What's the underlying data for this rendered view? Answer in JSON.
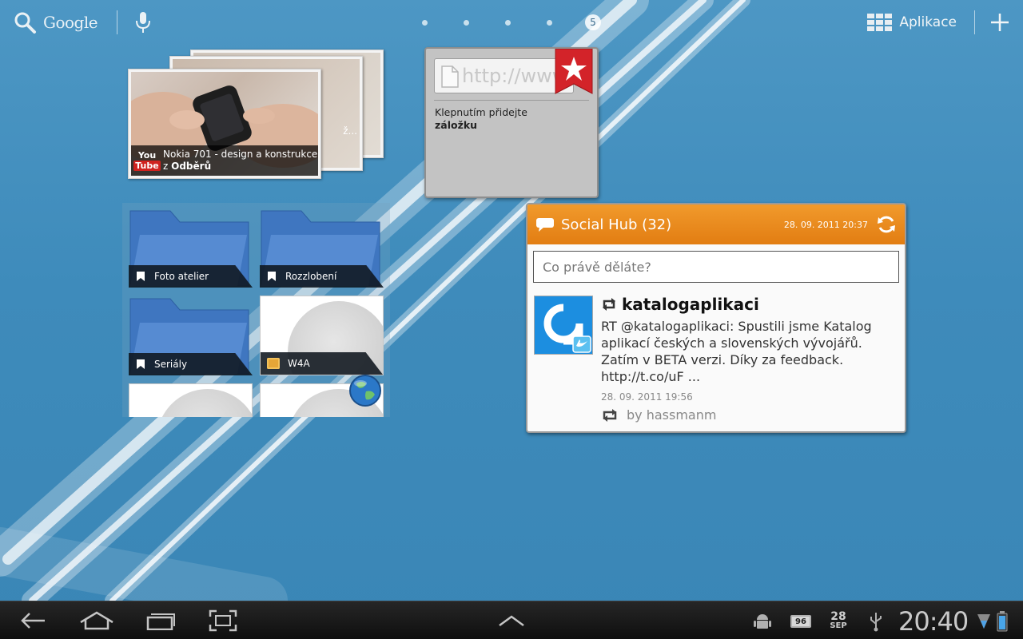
{
  "topbar": {
    "search_label": "Google",
    "page_number": "5",
    "apps_label": "Aplikace"
  },
  "youtube_widget": {
    "video_title": "Nokia 701 - design a konstrukce",
    "source_prefix": "z",
    "source_name": "Odběrů",
    "back_card_snippet": "ž...",
    "logo_top": "You",
    "logo_bottom": "Tube"
  },
  "bookmark_widget": {
    "url_placeholder": "http://www",
    "hint_line1": "Klepnutím přidejte",
    "hint_line2": "záložku"
  },
  "folders": {
    "items": [
      {
        "label": "Foto atelier"
      },
      {
        "label": "Rozzlobení"
      },
      {
        "label": "Seriály"
      },
      {
        "label": "W4A"
      }
    ]
  },
  "social_hub": {
    "title": "Social Hub (32)",
    "timestamp": "28. 09. 2011 20:37",
    "status_placeholder": "Co právě děláte?",
    "post": {
      "user": "katalogaplikaci",
      "text": "RT @katalogaplikaci: Spustili jsme Katalog aplikací českých a slovenských vývojářů. Zatím v BETA verzi. Díky za feedback. http://t.co/uF ...",
      "date": "28. 09. 2011 19:56",
      "by": "by hassmanm"
    },
    "accent_color": "#e98a1e"
  },
  "systembar": {
    "clock": "20:40",
    "calendar_day": "28",
    "calendar_month": "SEP",
    "battery_badge": "96"
  }
}
